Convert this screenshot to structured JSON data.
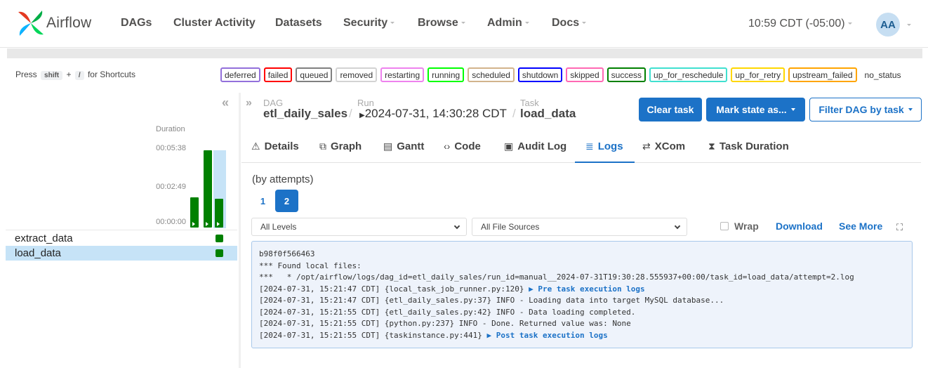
{
  "nav": {
    "brand": "Airflow",
    "items": [
      "DAGs",
      "Cluster Activity",
      "Datasets",
      "Security",
      "Browse",
      "Admin",
      "Docs"
    ],
    "time": "10:59 CDT (-05:00)",
    "avatar": "AA"
  },
  "shortcuts": {
    "prefix": "Press",
    "key1": "shift",
    "plus": "+",
    "key2": "/",
    "suffix": "for Shortcuts"
  },
  "legend": [
    {
      "label": "deferred",
      "color": "#9370db"
    },
    {
      "label": "failed",
      "color": "#ff0000"
    },
    {
      "label": "queued",
      "color": "#808080"
    },
    {
      "label": "removed",
      "color": "#d3d3d3"
    },
    {
      "label": "restarting",
      "color": "#ee82ee"
    },
    {
      "label": "running",
      "color": "#00ff00"
    },
    {
      "label": "scheduled",
      "color": "#d2b48c"
    },
    {
      "label": "shutdown",
      "color": "#0000ff"
    },
    {
      "label": "skipped",
      "color": "#ff69b4"
    },
    {
      "label": "success",
      "color": "#008000"
    },
    {
      "label": "up_for_reschedule",
      "color": "#40e0d0"
    },
    {
      "label": "up_for_retry",
      "color": "#ffd700"
    },
    {
      "label": "upstream_failed",
      "color": "#ffa500"
    },
    {
      "label": "no_status",
      "color": "transparent"
    }
  ],
  "grid": {
    "duration_title": "Duration",
    "ticks": [
      "00:05:38",
      "00:02:49",
      "00:00:00"
    ],
    "run_durations_fraction": [
      0.39,
      1.0,
      0.37
    ],
    "tasks": [
      "extract_data",
      "load_data"
    ],
    "selected_task": "load_data"
  },
  "breadcrumb": {
    "dag_label": "DAG",
    "dag": "etl_daily_sales",
    "run_label": "Run",
    "run": "2024-07-31, 14:30:28 CDT",
    "task_label": "Task",
    "task": "load_data"
  },
  "actions": {
    "clear": "Clear task",
    "mark": "Mark state as...",
    "filter": "Filter DAG by task"
  },
  "tabs": [
    {
      "label": "Details",
      "icon": "warning-triangle-icon",
      "glyph": "⚠"
    },
    {
      "label": "Graph",
      "icon": "graph-icon",
      "glyph": "⧉"
    },
    {
      "label": "Gantt",
      "icon": "gantt-icon",
      "glyph": "▤"
    },
    {
      "label": "Code",
      "icon": "code-icon",
      "glyph": "‹›"
    },
    {
      "label": "Audit Log",
      "icon": "audit-icon",
      "glyph": "▣"
    },
    {
      "label": "Logs",
      "icon": "list-icon",
      "glyph": "≣"
    },
    {
      "label": "XCom",
      "icon": "swap-icon",
      "glyph": "⇄"
    },
    {
      "label": "Task Duration",
      "icon": "hourglass-icon",
      "glyph": "⧗"
    }
  ],
  "active_tab": "Logs",
  "logs": {
    "attempts_label": "(by attempts)",
    "attempts": [
      "1",
      "2"
    ],
    "active_attempt": "2",
    "level_select": "All Levels",
    "source_select": "All File Sources",
    "wrap": "Wrap",
    "download": "Download",
    "see_more": "See More",
    "lines": [
      {
        "text": "b98f0f566463"
      },
      {
        "text": "*** Found local files:"
      },
      {
        "text": "***   * /opt/airflow/logs/dag_id=etl_daily_sales/run_id=manual__2024-07-31T19:30:28.555937+00:00/task_id=load_data/attempt=2.log"
      },
      {
        "text": "[2024-07-31, 15:21:47 CDT] {local_task_job_runner.py:120} ",
        "link": "▶ Pre task execution logs"
      },
      {
        "text": "[2024-07-31, 15:21:47 CDT] {etl_daily_sales.py:37} INFO - Loading data into target MySQL database..."
      },
      {
        "text": "[2024-07-31, 15:21:55 CDT] {etl_daily_sales.py:42} INFO - Data loading completed."
      },
      {
        "text": "[2024-07-31, 15:21:55 CDT] {python.py:237} INFO - Done. Returned value was: None"
      },
      {
        "text": "[2024-07-31, 15:21:55 CDT] {taskinstance.py:441} ",
        "link": "▶ Post task execution logs"
      }
    ]
  }
}
